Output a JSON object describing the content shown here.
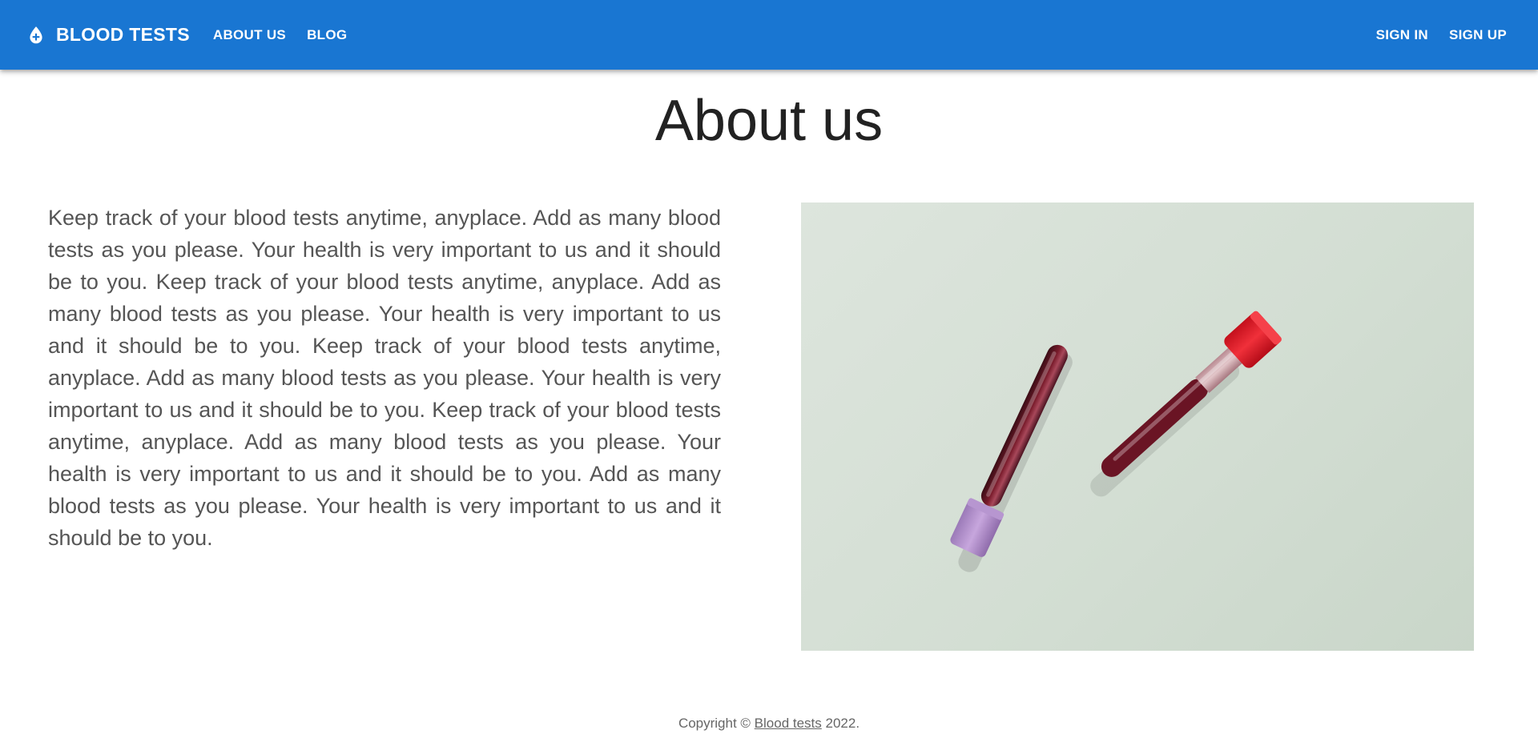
{
  "header": {
    "brand": "BLOOD TESTS",
    "brand_icon": "blood-drop-icon",
    "nav_left": [
      "ABOUT US",
      "BLOG"
    ],
    "nav_right": [
      "SIGN IN",
      "SIGN UP"
    ],
    "accent_color": "#1976d2"
  },
  "main": {
    "title": "About us",
    "paragraph": "Keep track of your blood tests anytime, anyplace. Add as many blood tests as you please. Your health is very important to us and it should be to you. Keep track of your blood tests anytime, anyplace. Add as many blood tests as you please. Your health is very important to us and it should be to you. Keep track of your blood tests anytime, anyplace. Add as many blood tests as you please. Your health is very important to us and it should be to you. Keep track of your blood tests anytime, anyplace. Add as many blood tests as you please. Your health is very important to us and it should be to you. Add as many blood tests as you please. Your health is very important to us and it should be to you."
  },
  "footer": {
    "prefix": "Copyright © ",
    "link": "Blood tests",
    "suffix": " 2022."
  }
}
